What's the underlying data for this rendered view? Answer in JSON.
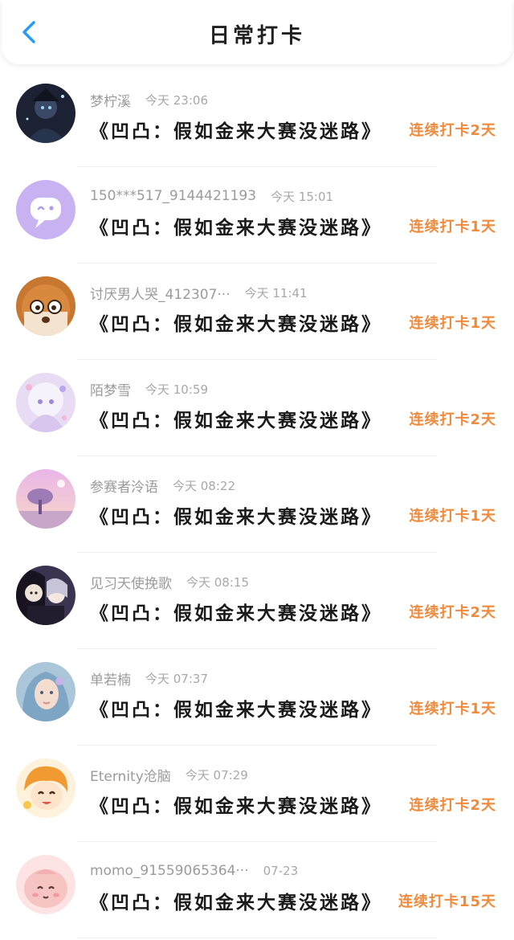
{
  "header": {
    "title": "日常打卡",
    "back_icon": "chevron-left-icon",
    "accent_color": "#2a9cf5"
  },
  "streak_color": "#f08a3c",
  "entries": [
    {
      "user": "梦柠溪",
      "time": "今天 23:06",
      "book": "《凹凸：假如金来大赛没迷路》",
      "streak": "连续打卡2天",
      "avatar": "dark-anime-avatar"
    },
    {
      "user": "150***517_9144421193",
      "time": "今天 15:01",
      "book": "《凹凸：假如金来大赛没迷路》",
      "streak": "连续打卡1天",
      "avatar": "default-chat-avatar"
    },
    {
      "user": "讨厌男人哭_412307···",
      "time": "今天 11:41",
      "book": "《凹凸：假如金来大赛没迷路》",
      "streak": "连续打卡1天",
      "avatar": "cookie-character-avatar"
    },
    {
      "user": "陌梦雪",
      "time": "今天 10:59",
      "book": "《凹凸：假如金来大赛没迷路》",
      "streak": "连续打卡2天",
      "avatar": "white-hair-anime-avatar"
    },
    {
      "user": "参赛者泠语",
      "time": "今天 08:22",
      "book": "《凹凸：假如金来大赛没迷路》",
      "streak": "连续打卡1天",
      "avatar": "pink-sky-tree-avatar"
    },
    {
      "user": "见习天使挽歌",
      "time": "今天 08:15",
      "book": "《凹凸：假如金来大赛没迷路》",
      "streak": "连续打卡2天",
      "avatar": "two-characters-avatar"
    },
    {
      "user": "单若楠",
      "time": "今天 07:37",
      "book": "《凹凸：假如金来大赛没迷路》",
      "streak": "连续打卡1天",
      "avatar": "blue-hair-girl-avatar"
    },
    {
      "user": "Eternity沧脑",
      "time": "今天 07:29",
      "book": "《凹凸：假如金来大赛没迷路》",
      "streak": "连续打卡2天",
      "avatar": "orange-chibi-avatar"
    },
    {
      "user": "momo_91559065364···",
      "time": "07-23",
      "book": "《凹凸：假如金来大赛没迷路》",
      "streak": "连续打卡15天",
      "avatar": "pink-blob-avatar"
    }
  ]
}
